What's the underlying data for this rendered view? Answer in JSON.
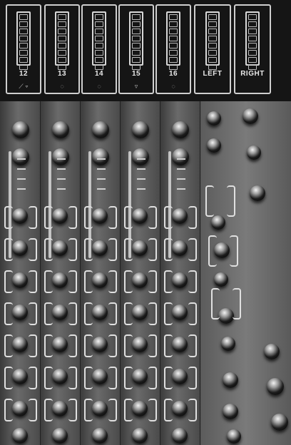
{
  "meters": [
    {
      "label": "12"
    },
    {
      "label": "13"
    },
    {
      "label": "14"
    },
    {
      "label": "15"
    },
    {
      "label": "16"
    },
    {
      "label": "LEFT"
    },
    {
      "label": "RIGHT"
    }
  ],
  "colors": {
    "panel": "#4a4a4a",
    "bridge": "#151515",
    "markings": "#e0e0e0",
    "knob": "#1c1c1c"
  }
}
